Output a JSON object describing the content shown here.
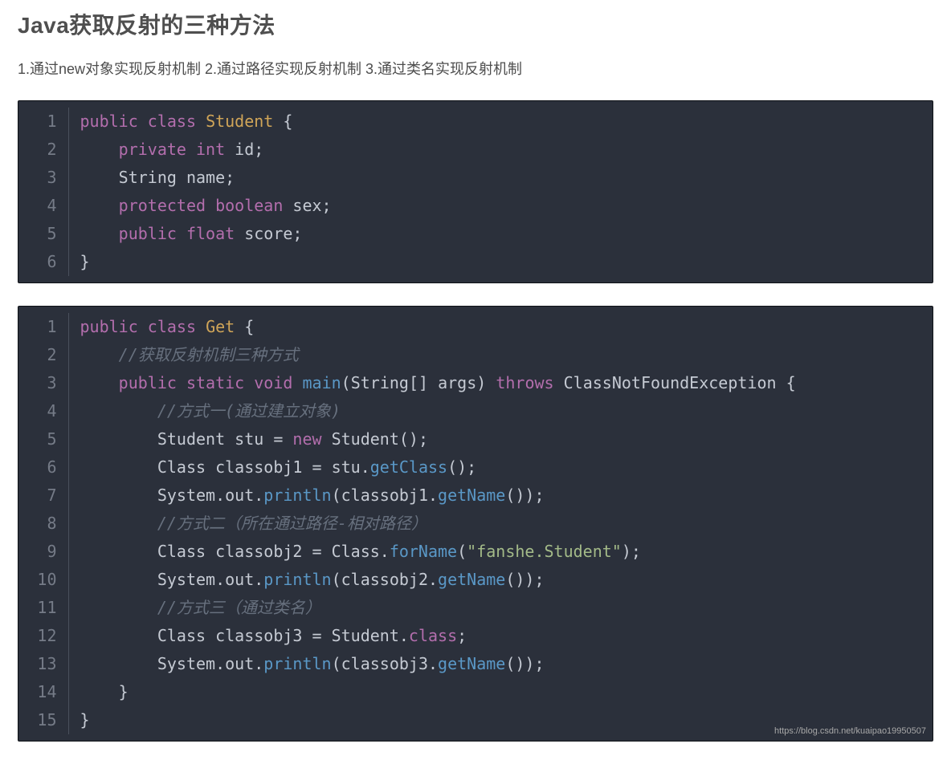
{
  "heading": "Java获取反射的三种方法",
  "intro": "1.通过new对象实现反射机制 2.通过路径实现反射机制 3.通过类名实现反射机制",
  "footer_url": "https://blog.csdn.net/kuaipao19950507",
  "block1": {
    "lines": [
      {
        "n": "1",
        "tokens": [
          {
            "t": "public",
            "cls": "kw"
          },
          {
            "t": " ",
            "cls": "plain"
          },
          {
            "t": "class",
            "cls": "kw"
          },
          {
            "t": " ",
            "cls": "plain"
          },
          {
            "t": "Student",
            "cls": "type"
          },
          {
            "t": " {",
            "cls": "plain"
          }
        ]
      },
      {
        "n": "2",
        "tokens": [
          {
            "t": "    ",
            "cls": "plain"
          },
          {
            "t": "private",
            "cls": "kw"
          },
          {
            "t": " ",
            "cls": "plain"
          },
          {
            "t": "int",
            "cls": "kw"
          },
          {
            "t": " id;",
            "cls": "plain"
          }
        ]
      },
      {
        "n": "3",
        "tokens": [
          {
            "t": "    String name;",
            "cls": "plain"
          }
        ]
      },
      {
        "n": "4",
        "tokens": [
          {
            "t": "    ",
            "cls": "plain"
          },
          {
            "t": "protected",
            "cls": "kw"
          },
          {
            "t": " ",
            "cls": "plain"
          },
          {
            "t": "boolean",
            "cls": "kw"
          },
          {
            "t": " sex;",
            "cls": "plain"
          }
        ]
      },
      {
        "n": "5",
        "tokens": [
          {
            "t": "    ",
            "cls": "plain"
          },
          {
            "t": "public",
            "cls": "kw"
          },
          {
            "t": " ",
            "cls": "plain"
          },
          {
            "t": "float",
            "cls": "kw"
          },
          {
            "t": " score;",
            "cls": "plain"
          }
        ]
      },
      {
        "n": "6",
        "tokens": [
          {
            "t": "}",
            "cls": "plain"
          }
        ]
      }
    ]
  },
  "block2": {
    "lines": [
      {
        "n": "1",
        "tokens": [
          {
            "t": "public",
            "cls": "kw"
          },
          {
            "t": " ",
            "cls": "plain"
          },
          {
            "t": "class",
            "cls": "kw"
          },
          {
            "t": " ",
            "cls": "plain"
          },
          {
            "t": "Get",
            "cls": "type"
          },
          {
            "t": " {",
            "cls": "plain"
          }
        ]
      },
      {
        "n": "2",
        "tokens": [
          {
            "t": "    ",
            "cls": "plain"
          },
          {
            "t": "//获取反射机制三种方式",
            "cls": "cm"
          }
        ]
      },
      {
        "n": "3",
        "tokens": [
          {
            "t": "    ",
            "cls": "plain"
          },
          {
            "t": "public",
            "cls": "kw"
          },
          {
            "t": " ",
            "cls": "plain"
          },
          {
            "t": "static",
            "cls": "kw"
          },
          {
            "t": " ",
            "cls": "plain"
          },
          {
            "t": "void",
            "cls": "kw"
          },
          {
            "t": " ",
            "cls": "plain"
          },
          {
            "t": "main",
            "cls": "fn"
          },
          {
            "t": "(String[] args)",
            "cls": "plain"
          },
          {
            "t": " ",
            "cls": "plain"
          },
          {
            "t": "throws",
            "cls": "kw"
          },
          {
            "t": " ClassNotFoundException {",
            "cls": "plain"
          }
        ]
      },
      {
        "n": "4",
        "tokens": [
          {
            "t": "        ",
            "cls": "plain"
          },
          {
            "t": "//方式一(通过建立对象)",
            "cls": "cm"
          }
        ]
      },
      {
        "n": "5",
        "tokens": [
          {
            "t": "        Student stu = ",
            "cls": "plain"
          },
          {
            "t": "new",
            "cls": "kw"
          },
          {
            "t": " Student();",
            "cls": "plain"
          }
        ]
      },
      {
        "n": "6",
        "tokens": [
          {
            "t": "        Class classobj1 = stu.",
            "cls": "plain"
          },
          {
            "t": "getClass",
            "cls": "fn"
          },
          {
            "t": "();",
            "cls": "plain"
          }
        ]
      },
      {
        "n": "7",
        "tokens": [
          {
            "t": "        System.out.",
            "cls": "plain"
          },
          {
            "t": "println",
            "cls": "fn"
          },
          {
            "t": "(classobj1.",
            "cls": "plain"
          },
          {
            "t": "getName",
            "cls": "fn"
          },
          {
            "t": "());",
            "cls": "plain"
          }
        ]
      },
      {
        "n": "8",
        "tokens": [
          {
            "t": "        ",
            "cls": "plain"
          },
          {
            "t": "//方式二（所在通过路径-相对路径）",
            "cls": "cm"
          }
        ]
      },
      {
        "n": "9",
        "tokens": [
          {
            "t": "        Class classobj2 = Class.",
            "cls": "plain"
          },
          {
            "t": "forName",
            "cls": "fn"
          },
          {
            "t": "(",
            "cls": "plain"
          },
          {
            "t": "\"fanshe.Student\"",
            "cls": "str"
          },
          {
            "t": ");",
            "cls": "plain"
          }
        ]
      },
      {
        "n": "10",
        "tokens": [
          {
            "t": "        System.out.",
            "cls": "plain"
          },
          {
            "t": "println",
            "cls": "fn"
          },
          {
            "t": "(classobj2.",
            "cls": "plain"
          },
          {
            "t": "getName",
            "cls": "fn"
          },
          {
            "t": "());",
            "cls": "plain"
          }
        ]
      },
      {
        "n": "11",
        "tokens": [
          {
            "t": "        ",
            "cls": "plain"
          },
          {
            "t": "//方式三（通过类名）",
            "cls": "cm"
          }
        ]
      },
      {
        "n": "12",
        "tokens": [
          {
            "t": "        Class classobj3 = Student.",
            "cls": "plain"
          },
          {
            "t": "class",
            "cls": "kw"
          },
          {
            "t": ";",
            "cls": "plain"
          }
        ]
      },
      {
        "n": "13",
        "tokens": [
          {
            "t": "        System.out.",
            "cls": "plain"
          },
          {
            "t": "println",
            "cls": "fn"
          },
          {
            "t": "(classobj3.",
            "cls": "plain"
          },
          {
            "t": "getName",
            "cls": "fn"
          },
          {
            "t": "());",
            "cls": "plain"
          }
        ]
      },
      {
        "n": "14",
        "tokens": [
          {
            "t": "    }",
            "cls": "plain"
          }
        ]
      },
      {
        "n": "15",
        "tokens": [
          {
            "t": "}",
            "cls": "plain"
          }
        ]
      }
    ]
  }
}
